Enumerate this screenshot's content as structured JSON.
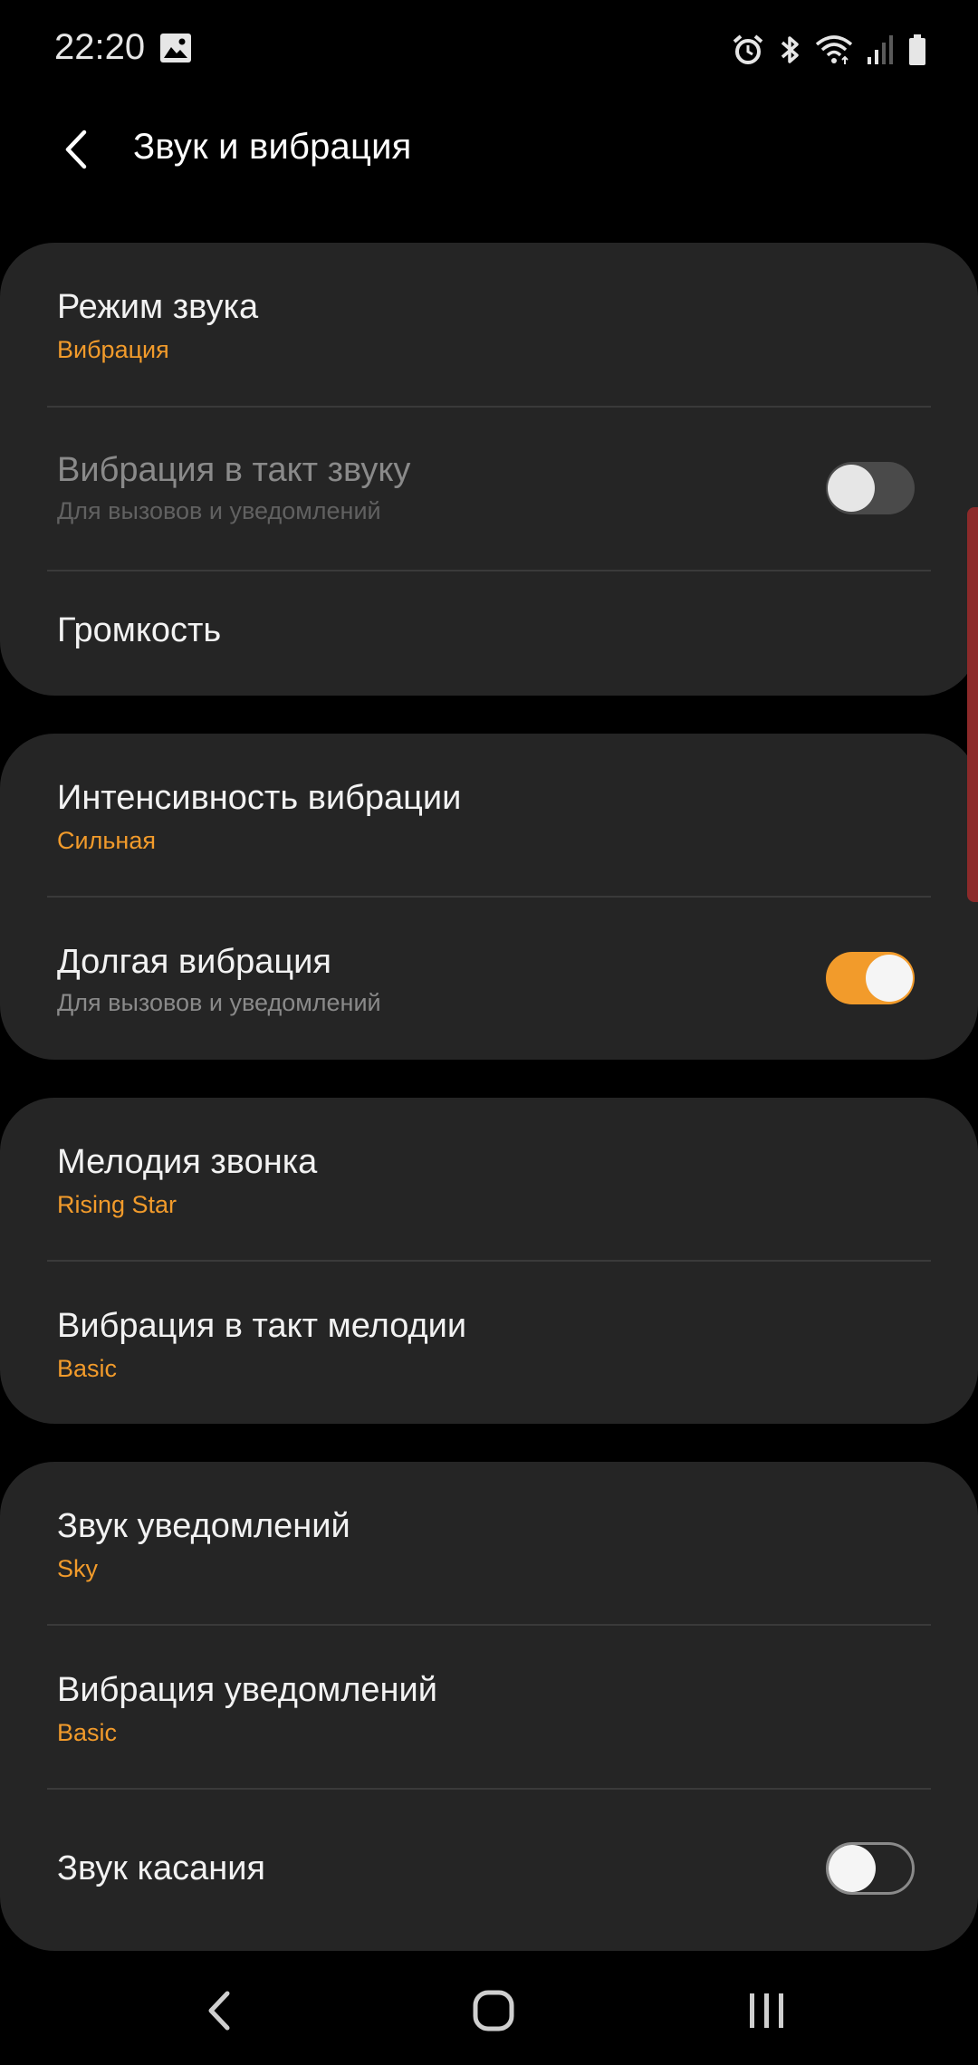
{
  "status_bar": {
    "time": "22:20",
    "icons": [
      "gallery-icon",
      "alarm-icon",
      "bluetooth-icon",
      "wifi-icon",
      "signal-icon",
      "battery-icon"
    ]
  },
  "header": {
    "title": "Звук и вибрация",
    "back_icon": "chevron-left-icon"
  },
  "groups": [
    {
      "items": [
        {
          "title": "Режим звука",
          "subtitle": "Вибрация",
          "subtitle_style": "accent"
        },
        {
          "title": "Вибрация в такт звуку",
          "subtitle": "Для вызовов и уведомлений",
          "toggle": "off",
          "disabled": true
        },
        {
          "title": "Громкость"
        }
      ]
    },
    {
      "items": [
        {
          "title": "Интенсивность вибрации",
          "subtitle": "Сильная",
          "subtitle_style": "accent"
        },
        {
          "title": "Долгая вибрация",
          "subtitle": "Для вызовов и уведомлений",
          "toggle": "on"
        }
      ]
    },
    {
      "items": [
        {
          "title": "Мелодия звонка",
          "subtitle": "Rising Star",
          "subtitle_style": "accent"
        },
        {
          "title": "Вибрация в такт мелодии",
          "subtitle": "Basic",
          "subtitle_style": "accent"
        }
      ]
    },
    {
      "items": [
        {
          "title": "Звук уведомлений",
          "subtitle": "Sky",
          "subtitle_style": "accent"
        },
        {
          "title": "Вибрация уведомлений",
          "subtitle": "Basic",
          "subtitle_style": "accent"
        },
        {
          "title": "Звук касания",
          "toggle": "off"
        }
      ]
    }
  ],
  "nav_bar": {
    "back": "back-icon",
    "home": "home-icon",
    "recents": "recents-icon"
  },
  "colors": {
    "background": "#000000",
    "card": "#252525",
    "accent": "#f29b2b",
    "text": "#f2f2f2",
    "muted": "#8a8a8a"
  }
}
